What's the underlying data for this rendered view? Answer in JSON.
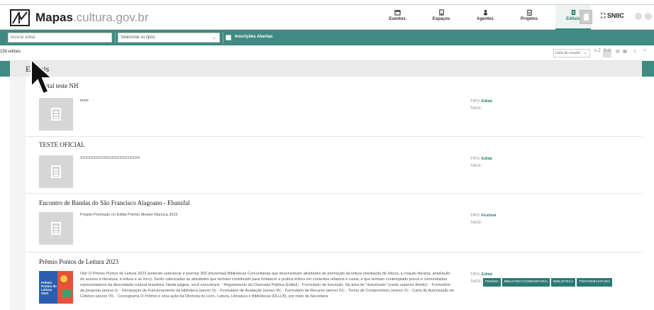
{
  "header": {
    "brand_name": "Mapas",
    "brand_suffix": ".cultura.gov.br",
    "nav": [
      {
        "label": "Eventos",
        "icon": "calendar-icon"
      },
      {
        "label": "Espaços",
        "icon": "building-icon"
      },
      {
        "label": "Agentes",
        "icon": "person-icon"
      },
      {
        "label": "Projetos",
        "icon": "clipboard-icon"
      },
      {
        "label": "Editais",
        "icon": "document-icon",
        "active": true
      }
    ],
    "sniic_label": "SNIIC"
  },
  "filters": {
    "search_placeholder": "Buscar edital",
    "type_select": "Selecione os tipos",
    "open_label": "Inscrições Abertas"
  },
  "toolbar": {
    "count": "159 editais",
    "sort_label": "Data de criação",
    "list_label": "A-Z",
    "grid_label": "Z-A"
  },
  "panel": {
    "title": "Editais"
  },
  "cards": [
    {
      "title": "Edital teste NH",
      "description": "teste",
      "tipo_label": "TIPO:",
      "tipo": "Edital",
      "tags_label": "TAGS:",
      "tags": []
    },
    {
      "title": "TESTE OFICIAL",
      "description": "XXXXXXXXXXXXXXXXXXXXXXX",
      "tipo_label": "TIPO:",
      "tipo": "Edital",
      "tags_label": "TAGS:",
      "tags": []
    },
    {
      "title": "Encontro de Bandas do São Francisco Alagoano - Ebansfal",
      "description": "Projeto Premiado no Edital Prêmio Mestre Manuca 2022",
      "tipo_label": "TIPO:",
      "tipo": "Festival",
      "tags_label": "TAGS:",
      "tags": []
    },
    {
      "title": "Prêmio Pontos de Leitura 2023",
      "description": "Olá! O Prêmio Pontos de Leitura 2023 pretende selecionar e premiar 300 (trezentas) Bibliotecas Comunitárias que desenvolvam atividades de promoção da leitura (mediação de leitura, a criação literária, ampliação do acesso à literatura, à leitura e ao livro). Serão valorizadas as atividades que tenham contribuído para fortalecer a prática leitora em contextos urbanos e rurais, e que tenham contemplado povos e comunidades representativos da diversidade cultural brasileira. Nesta página, você encontrará: - Regulamento da Chamada Pública (Edital); - Formulário de Inscrição. Na área de \"downloads\" (canto superior direito): - Formulário da proposta (anexo I); - Declaração de Funcionamento da biblioteca (anexo II); - Formulário de Avaliação (anexo III); - Formulário de Recurso (anexo IV); - Termo de Compromisso (anexo V); - Carta de Autorização do Coletivo (anexo VI). - Cronograma O Prêmio é uma ação da Diretoria do Livro, Leitura, Literatura e Bibliotecas (DLLLB), por meio da Secretaria",
      "tipo_label": "TIPO:",
      "tipo": "Edital",
      "tags_label": "TAGS:",
      "tags": [
        "PREMIO",
        "BIBLIOTECACOMUNITARIA",
        "BIBLIOTECA",
        "PONTODELEITURA"
      ],
      "cover_text": "Prêmio Pontos de Leitura 2023"
    }
  ]
}
